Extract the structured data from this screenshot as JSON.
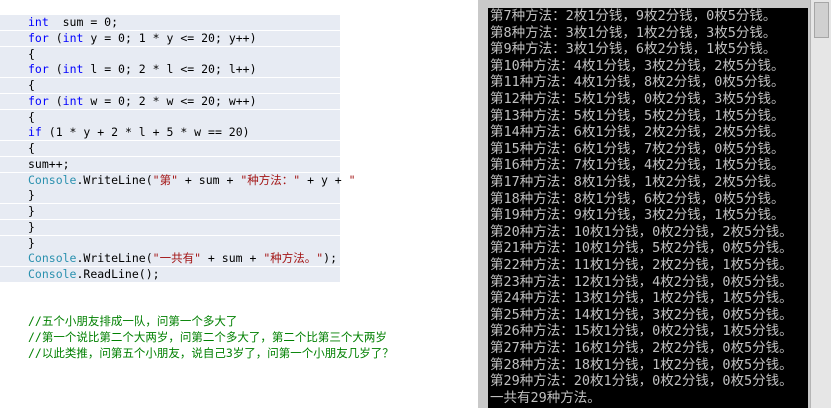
{
  "editor": {
    "code_lines": [
      {
        "indent": 0,
        "hl": true,
        "parts": [
          [
            "kw",
            "int"
          ],
          [
            "",
            "  sum = 0;"
          ]
        ]
      },
      {
        "indent": 0,
        "hl": true,
        "parts": [
          [
            "kw",
            "for"
          ],
          [
            "",
            " ("
          ],
          [
            "kw",
            "int"
          ],
          [
            "",
            " y = 0; 1 * y <= 20; y++)"
          ]
        ]
      },
      {
        "indent": 0,
        "hl": true,
        "parts": [
          [
            "",
            "{"
          ]
        ]
      },
      {
        "indent": 1,
        "hl": true,
        "parts": [
          [
            "kw",
            "for"
          ],
          [
            "",
            " ("
          ],
          [
            "kw",
            "int"
          ],
          [
            "",
            " l = 0; 2 * l <= 20; l++)"
          ]
        ]
      },
      {
        "indent": 1,
        "hl": true,
        "parts": [
          [
            "",
            "{"
          ]
        ]
      },
      {
        "indent": 2,
        "hl": true,
        "parts": [
          [
            "kw",
            "for"
          ],
          [
            "",
            " ("
          ],
          [
            "kw",
            "int"
          ],
          [
            "",
            " w = 0; 2 * w <= 20; w++)"
          ]
        ]
      },
      {
        "indent": 2,
        "hl": true,
        "parts": [
          [
            "",
            "{"
          ]
        ]
      },
      {
        "indent": 3,
        "hl": true,
        "parts": [
          [
            "kw",
            "if"
          ],
          [
            "",
            " (1 * y + 2 * l + 5 * w == 20)"
          ]
        ]
      },
      {
        "indent": 3,
        "hl": true,
        "parts": [
          [
            "",
            "{"
          ]
        ]
      },
      {
        "indent": 4,
        "hl": true,
        "parts": [
          [
            "",
            "sum++;"
          ]
        ]
      },
      {
        "indent": 4,
        "hl": true,
        "parts": [
          [
            "typ",
            "Console"
          ],
          [
            "",
            ".WriteLine("
          ],
          [
            "str",
            "\"第\""
          ],
          [
            "",
            " + sum + "
          ],
          [
            "str",
            "\"种方法：\""
          ],
          [
            "",
            " + y + "
          ],
          [
            "str",
            "\""
          ]
        ]
      },
      {
        "indent": 3,
        "hl": true,
        "parts": [
          [
            "",
            "}"
          ]
        ]
      },
      {
        "indent": 2,
        "hl": true,
        "parts": [
          [
            "",
            "}"
          ]
        ]
      },
      {
        "indent": 1,
        "hl": true,
        "parts": [
          [
            "",
            "}"
          ]
        ]
      },
      {
        "indent": 0,
        "hl": true,
        "parts": [
          [
            "",
            "}"
          ]
        ]
      },
      {
        "indent": 0,
        "hl": true,
        "parts": [
          [
            "typ",
            "Console"
          ],
          [
            "",
            ".WriteLine("
          ],
          [
            "str",
            "\"一共有\""
          ],
          [
            "",
            " + sum + "
          ],
          [
            "str",
            "\"种方法。\""
          ],
          [
            "",
            ");"
          ]
        ]
      },
      {
        "indent": 0,
        "hl": true,
        "parts": [
          [
            "typ",
            "Console"
          ],
          [
            "",
            ".ReadLine();"
          ]
        ]
      },
      {
        "indent": 0,
        "hl": false,
        "parts": []
      },
      {
        "indent": 0,
        "hl": false,
        "parts": []
      },
      {
        "indent": 0,
        "hl": false,
        "parts": [
          [
            "cm",
            "//五个小朋友排成一队，问第一个多大了"
          ]
        ]
      },
      {
        "indent": 0,
        "hl": false,
        "parts": [
          [
            "cm",
            "//第一个说比第二个大两岁，问第二个多大了，第二个比第三个大两岁"
          ]
        ]
      },
      {
        "indent": 0,
        "hl": false,
        "parts": [
          [
            "cm",
            "//以此类推，问第五个小朋友，说自己3岁了，问第一个小朋友几岁了？"
          ]
        ]
      }
    ]
  },
  "console": {
    "colors": {
      "background": "#000000",
      "text": "#c0c0c0"
    },
    "output_lines": [
      "第7种方法：2枚1分钱，9枚2分钱，0枚5分钱。",
      "第8种方法：3枚1分钱，1枚2分钱，3枚5分钱。",
      "第9种方法：3枚1分钱，6枚2分钱，1枚5分钱。",
      "第10种方法：4枚1分钱，3枚2分钱，2枚5分钱。",
      "第11种方法：4枚1分钱，8枚2分钱，0枚5分钱。",
      "第12种方法：5枚1分钱，0枚2分钱，3枚5分钱。",
      "第13种方法：5枚1分钱，5枚2分钱，1枚5分钱。",
      "第14种方法：6枚1分钱，2枚2分钱，2枚5分钱。",
      "第15种方法：6枚1分钱，7枚2分钱，0枚5分钱。",
      "第16种方法：7枚1分钱，4枚2分钱，1枚5分钱。",
      "第17种方法：8枚1分钱，1枚2分钱，2枚5分钱。",
      "第18种方法：8枚1分钱，6枚2分钱，0枚5分钱。",
      "第19种方法：9枚1分钱，3枚2分钱，1枚5分钱。",
      "第20种方法：10枚1分钱，0枚2分钱，2枚5分钱。",
      "第21种方法：10枚1分钱，5枚2分钱，0枚5分钱。",
      "第22种方法：11枚1分钱，2枚2分钱，1枚5分钱。",
      "第23种方法：12枚1分钱，4枚2分钱，0枚5分钱。",
      "第24种方法：13枚1分钱，1枚2分钱，1枚5分钱。",
      "第25种方法：14枚1分钱，3枚2分钱，0枚5分钱。",
      "第26种方法：15枚1分钱，0枚2分钱，1枚5分钱。",
      "第27种方法：16枚1分钱，2枚2分钱，0枚5分钱。",
      "第28种方法：18枚1分钱，1枚2分钱，0枚5分钱。",
      "第29种方法：20枚1分钱，0枚2分钱，0枚5分钱。",
      "一共有29种方法。"
    ]
  }
}
